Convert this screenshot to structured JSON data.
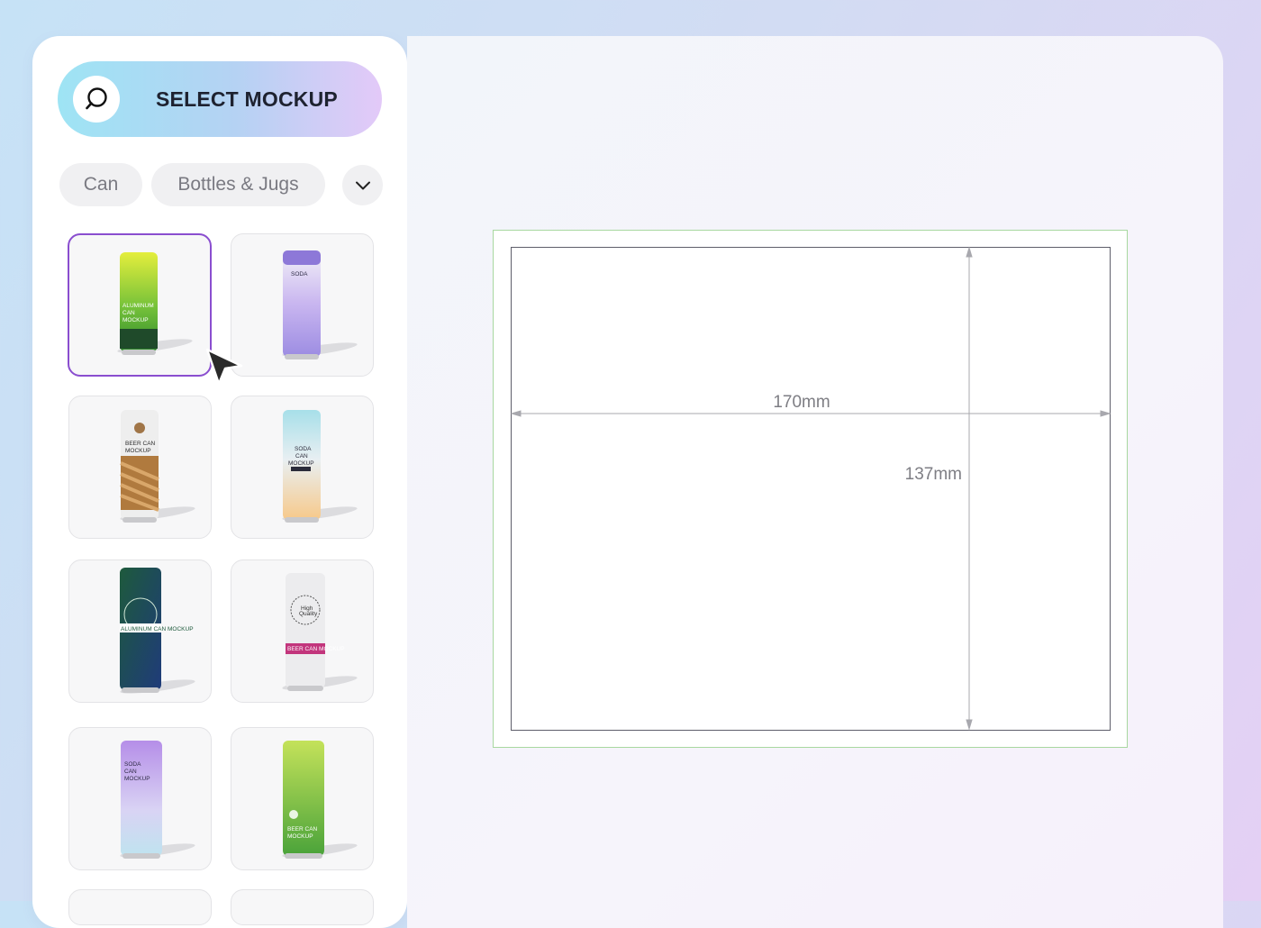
{
  "sidebar": {
    "select_button": {
      "label": "SELECT MOCKUP",
      "icon": "search-icon"
    },
    "chips": [
      {
        "label": "Can"
      },
      {
        "label": "Bottles & Jugs"
      }
    ],
    "more_icon": "chevron-down-icon",
    "mockups": [
      {
        "text": [
          "ALUMINUM",
          "CAN",
          "MOCKUP"
        ],
        "selected": true
      },
      {
        "text": [
          "SODA"
        ],
        "selected": false
      },
      {
        "text": [
          "BEER CAN",
          "MOCKUP"
        ],
        "selected": false
      },
      {
        "text": [
          "SODA",
          "CAN",
          "MOCKUP"
        ],
        "selected": false
      },
      {
        "text": [
          "ALUMINUM CAN MOCKUP"
        ],
        "selected": false
      },
      {
        "text": [
          "High",
          "Quality",
          "BEER CAN MOCKUP"
        ],
        "selected": false
      },
      {
        "text": [
          "SODA",
          "CAN",
          "MOCKUP"
        ],
        "selected": false
      },
      {
        "text": [
          "BEER CAN",
          "MOCKUP"
        ],
        "selected": false
      }
    ]
  },
  "canvas": {
    "width_label": "170mm",
    "height_label": "137mm"
  },
  "colors": {
    "accent": "#8a4ecf",
    "bleed_line": "#a8d8a0",
    "dimension_line": "#a8a8ae"
  }
}
